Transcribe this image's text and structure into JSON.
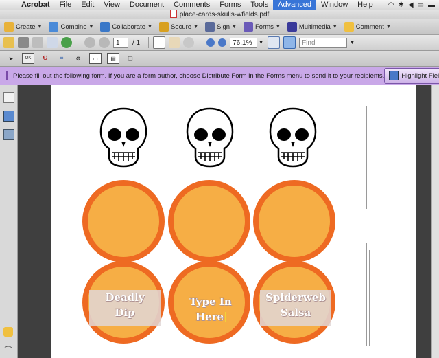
{
  "menubar": {
    "items": [
      "Acrobat",
      "File",
      "Edit",
      "View",
      "Document",
      "Comments",
      "Forms",
      "Tools",
      "Advanced",
      "Window",
      "Help"
    ],
    "active": "Advanced"
  },
  "window": {
    "title": "place-cards-skulls-wfields.pdf"
  },
  "task_toolbar": {
    "items": [
      {
        "label": "Create",
        "icon": "create-icon",
        "color": "#e8b23a"
      },
      {
        "label": "Combine",
        "icon": "combine-icon",
        "color": "#4a8ad8"
      },
      {
        "label": "Collaborate",
        "icon": "collaborate-icon",
        "color": "#3a78c8"
      },
      {
        "label": "Secure",
        "icon": "lock-icon",
        "color": "#d8a020"
      },
      {
        "label": "Sign",
        "icon": "pen-icon",
        "color": "#5a6a9a"
      },
      {
        "label": "Forms",
        "icon": "forms-icon",
        "color": "#6a5ab8"
      },
      {
        "label": "Multimedia",
        "icon": "multimedia-icon",
        "color": "#3a3a9a"
      },
      {
        "label": "Comment",
        "icon": "comment-icon",
        "color": "#f0c040"
      }
    ]
  },
  "nav_toolbar": {
    "page_current": "1",
    "page_total": "/ 1",
    "zoom": "76.1%",
    "find_placeholder": "Find"
  },
  "message_bar": {
    "text": "Please fill out the following form. If you are a form author, choose Distribute Form in the Forms menu to send it to your recipients.",
    "button": "Highlight Fields"
  },
  "form_fields": [
    {
      "line1": "Deadly",
      "line2": "Dip",
      "highlighted": true
    },
    {
      "line1": "Type In",
      "line2": "Here",
      "highlighted": false
    },
    {
      "line1": "Spiderweb",
      "line2": "Salsa",
      "highlighted": true
    }
  ],
  "colors": {
    "orange_ring": "#ee6a22",
    "orange_fill": "#f6ae45",
    "message_bar": "#c9a8e8",
    "teal_text": "#2aa8b8"
  }
}
